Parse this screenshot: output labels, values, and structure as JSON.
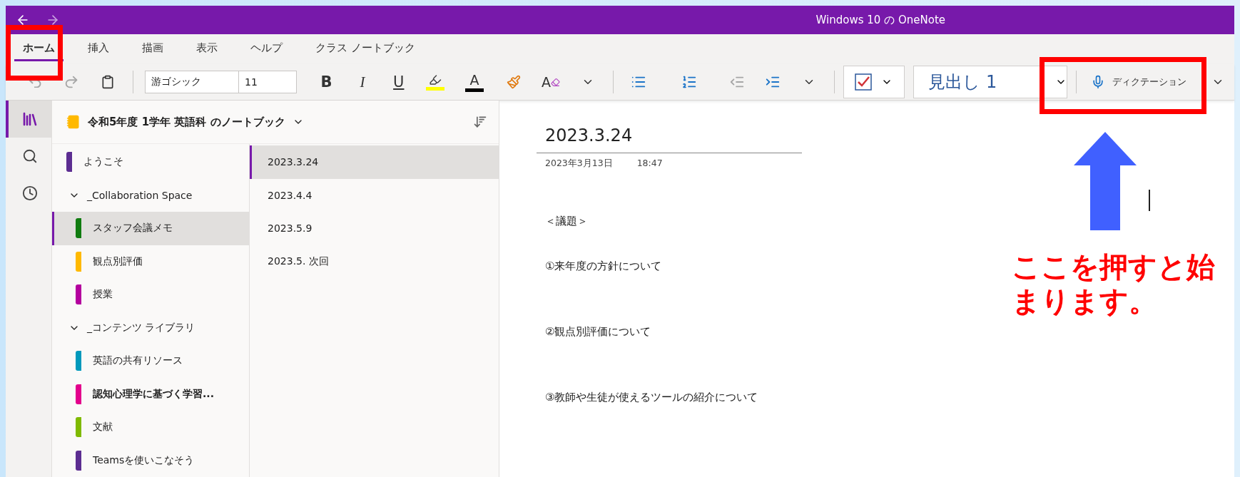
{
  "window": {
    "title": "Windows 10 の OneNote"
  },
  "ribbon_tabs": [
    {
      "label": "ホーム",
      "selected": true
    },
    {
      "label": "挿入",
      "selected": false
    },
    {
      "label": "描画",
      "selected": false
    },
    {
      "label": "表示",
      "selected": false
    },
    {
      "label": "ヘルプ",
      "selected": false
    },
    {
      "label": "クラス ノートブック",
      "selected": false
    }
  ],
  "toolbar": {
    "undo": {
      "disabled": true
    },
    "redo": {
      "disabled": true
    },
    "font_name": "游ゴシック",
    "font_size": "11",
    "format_buttons": [
      {
        "kind": "bold",
        "label": "B"
      },
      {
        "kind": "italic",
        "label": "I"
      },
      {
        "kind": "underline",
        "label": "U"
      }
    ],
    "font_color_label": "A",
    "clear_format_label": "A",
    "style": "見出し 1",
    "dictation": "ディクテーション"
  },
  "nav_rail": [
    {
      "kind": "notebooks",
      "selected": true
    },
    {
      "kind": "search",
      "selected": false
    },
    {
      "kind": "recent",
      "selected": false
    }
  ],
  "notebook": {
    "name": "令和5年度 1学年 英語科 のノートブック"
  },
  "sections": [
    {
      "kind": "section",
      "name": "ようこそ",
      "color": "#5c2d91",
      "selected": false,
      "bold": false
    },
    {
      "kind": "group",
      "name": "_Collaboration Space",
      "expanded": true,
      "children": [
        {
          "kind": "section",
          "name": "スタッフ会議メモ",
          "color": "#107c10",
          "selected": true,
          "bold": false
        },
        {
          "kind": "section",
          "name": "観点別評価",
          "color": "#ffb900",
          "selected": false,
          "bold": false
        },
        {
          "kind": "section",
          "name": "授業",
          "color": "#b4009e",
          "selected": false,
          "bold": false
        }
      ]
    },
    {
      "kind": "group",
      "name": "_コンテンツ ライブラリ",
      "expanded": true,
      "children": [
        {
          "kind": "section",
          "name": "英語の共有リソース",
          "color": "#0099bc",
          "selected": false,
          "bold": false
        },
        {
          "kind": "section",
          "name": "認知心理学に基づく学習...",
          "color": "#e3008c",
          "selected": false,
          "bold": true
        },
        {
          "kind": "section",
          "name": "文献",
          "color": "#7fba00",
          "selected": false,
          "bold": false
        },
        {
          "kind": "section",
          "name": "Teamsを使いこなそう",
          "color": "#5c2d91",
          "selected": false,
          "bold": false
        }
      ]
    }
  ],
  "pages": [
    {
      "title": "2023.3.24",
      "selected": true
    },
    {
      "title": "2023.4.4",
      "selected": false
    },
    {
      "title": "2023.5.9",
      "selected": false
    },
    {
      "title": "2023.5. 次回",
      "selected": false
    }
  ],
  "page": {
    "title": "2023.3.24",
    "date": "2023年3月13日",
    "time": "18:47",
    "paragraphs": [
      "＜議題＞",
      "①来年度の方針について",
      "②観点別評価について",
      "③教師や生徒が使えるツールの紹介について"
    ]
  },
  "annotation": {
    "callout": "ここを押すと始まります。"
  }
}
